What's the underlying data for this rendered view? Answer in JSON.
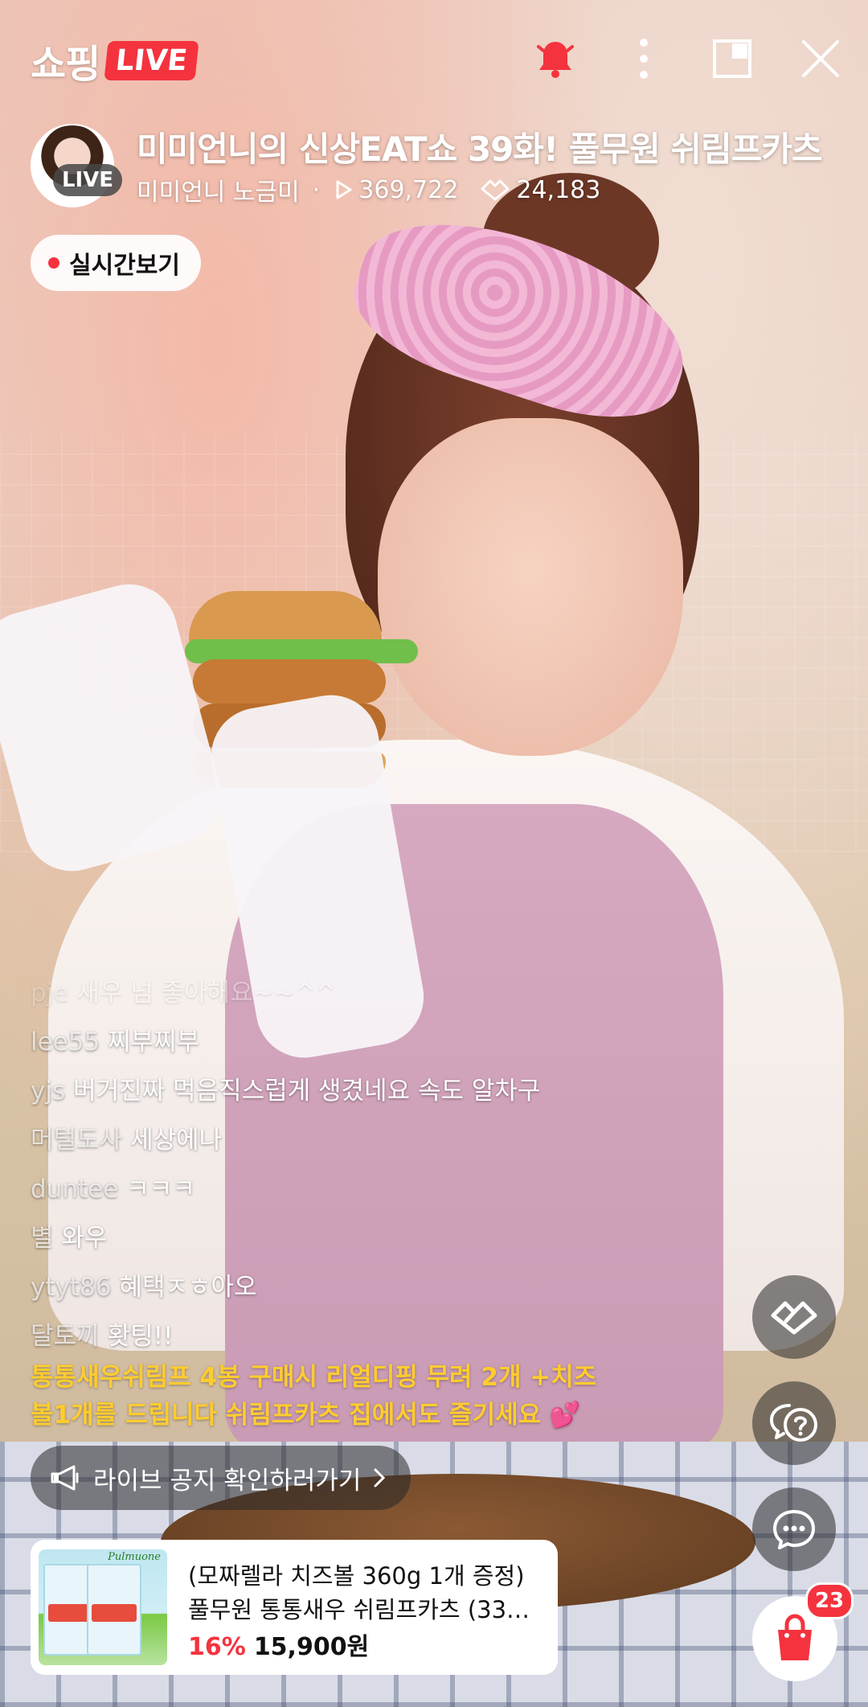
{
  "header": {
    "brand": "쇼핑",
    "live_badge": "LIVE"
  },
  "broadcast": {
    "title": "미미언니의 신상EAT쇼 39화! 풀무원 쉬림프카츠",
    "host": "미미언니 노금미",
    "separator": "·",
    "views": "369,722",
    "likes": "24,183",
    "avatar_live": "LIVE"
  },
  "realtime_button": {
    "label": "실시간보기"
  },
  "chat": [
    {
      "nick": "pje",
      "msg": "새우 넘 좋아해요~~^^",
      "faded": true
    },
    {
      "nick": "lee55",
      "msg": "찌부찌부"
    },
    {
      "nick": "yjs",
      "msg": "버거진짜 먹음직스럽게 생겼네요 속도 알차구"
    },
    {
      "nick": "머털도사",
      "msg": "세상에나"
    },
    {
      "nick": "duntee",
      "msg": "ㅋㅋㅋ"
    },
    {
      "nick": "별",
      "msg": "와우"
    },
    {
      "nick": "ytyt86",
      "msg": "혜택ㅈㅎ아오"
    },
    {
      "nick": "달토끼",
      "msg": "홧팅!!"
    }
  ],
  "notice": {
    "line1": "통통새우쉬림프 4봉 구매시 리얼디핑 무려 2개 +치즈",
    "line2": "볼1개를 드립니다 쉬림프카츠 집에서도 즐기세요 💕",
    "button_label": "라이브 공지 확인하러가기"
  },
  "product": {
    "line1": "(모짜렐라 치즈볼 360g 1개 증정)",
    "line2": "풀무원 통통새우 쉬림프카츠 (33…",
    "discount": "16%",
    "price": "15,900원",
    "thumb_brand": "Pulmuone"
  },
  "cart": {
    "count": "23"
  },
  "icons": {
    "bell": "bell-icon",
    "more": "more-vertical-icon",
    "pip": "picture-in-picture-icon",
    "close": "close-icon",
    "like": "heart-icon",
    "question": "question-chat-icon",
    "chat": "chat-icon",
    "cart": "shopping-bag-icon",
    "megaphone": "megaphone-icon"
  },
  "colors": {
    "accent_red": "#f4333e",
    "notice_yellow": "#ffcc2e"
  }
}
